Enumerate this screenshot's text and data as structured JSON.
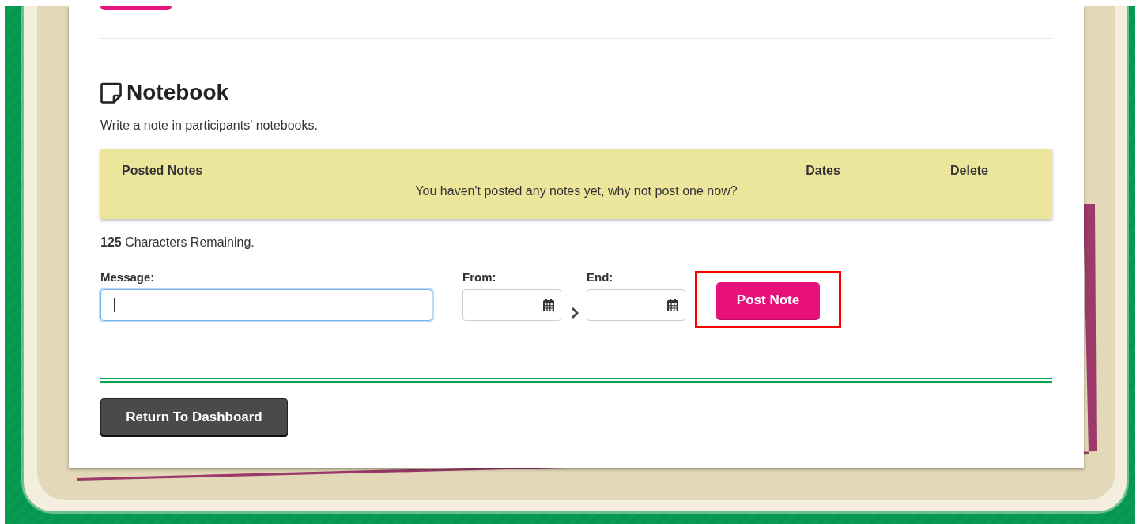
{
  "section": {
    "title": "Notebook",
    "description": "Write a note in participants' notebooks."
  },
  "notes_table": {
    "columns": [
      "Posted Notes",
      "Dates",
      "Delete"
    ],
    "empty_message": "You haven't posted any notes yet, why not post one now?"
  },
  "characters_remaining": "**125** Characters Remaining.",
  "form": {
    "message": {
      "label": "Message:",
      "focused": true
    },
    "from": {
      "label": "From:"
    },
    "end": {
      "label": "End:"
    },
    "submit": {
      "label": "Post Note",
      "highlighted": true
    }
  },
  "return_button": "Return To Dashboard"
}
